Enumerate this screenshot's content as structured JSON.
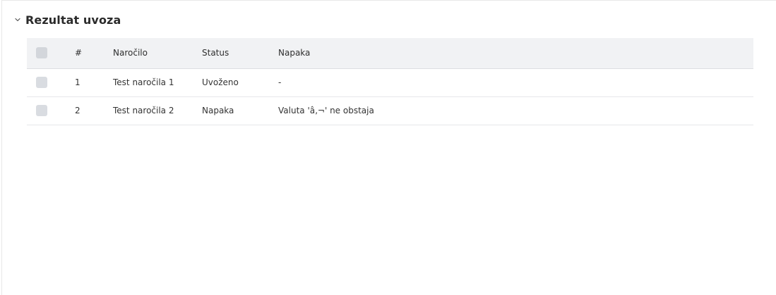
{
  "section": {
    "title": "Rezultat uvoza",
    "collapse_icon": "chevron-down-icon"
  },
  "table": {
    "columns": {
      "number": "#",
      "order": "Naročilo",
      "status": "Status",
      "error": "Napaka"
    },
    "rows": [
      {
        "number": "1",
        "order": "Test naročila 1",
        "status": "Uvoženo",
        "error": "-"
      },
      {
        "number": "2",
        "order": "Test naročila 2",
        "status": "Napaka",
        "error": "Valuta 'â‚¬' ne obstaja"
      }
    ]
  },
  "colors": {
    "header_bg": "#f1f2f4",
    "checkbox": "#d9dce1",
    "border": "#e6e7ea"
  }
}
